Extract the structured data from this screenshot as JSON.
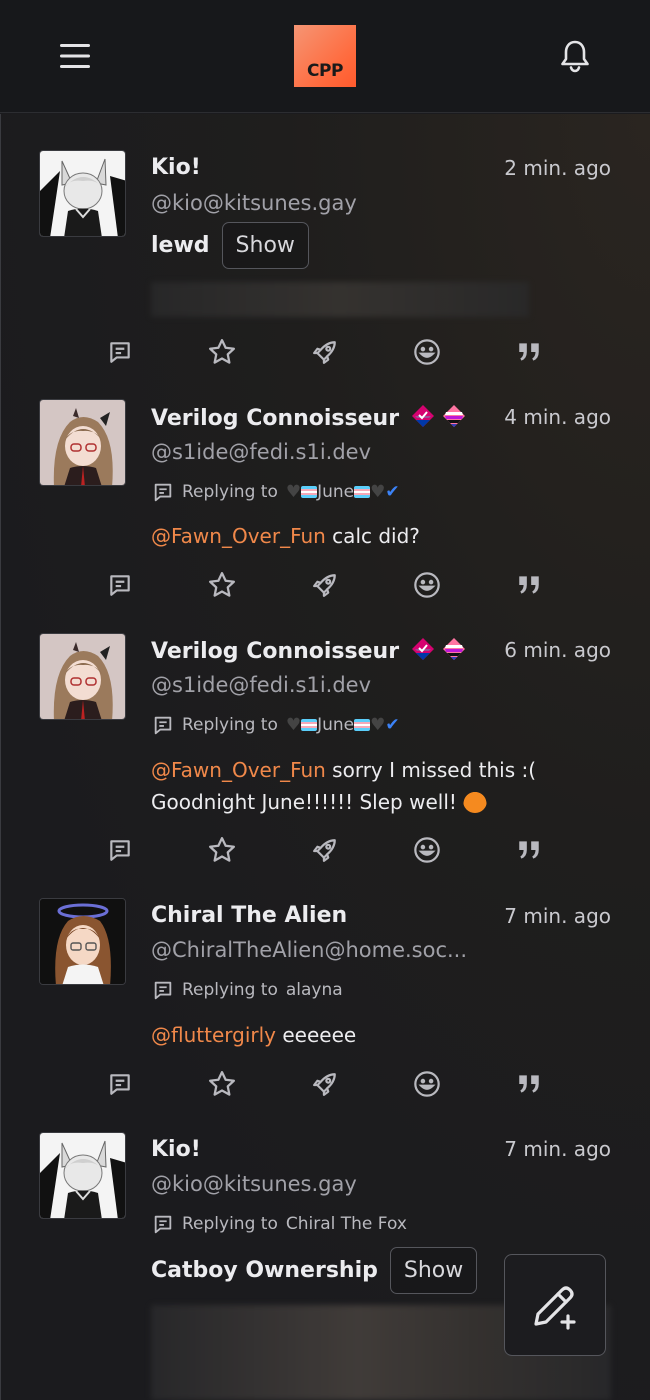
{
  "header": {
    "logo_text": "CPP",
    "menu_icon": "menu-icon",
    "bell_icon": "bell-icon"
  },
  "posts": [
    {
      "name": "Kio!",
      "handle": "@kio@kitsunes.gay",
      "time": "2 min. ago",
      "cw": "lewd",
      "show": "Show"
    },
    {
      "name": "Verilog Connoisseur",
      "handle": "@s1ide@fedi.s1i.dev",
      "time": "4 min. ago",
      "reply_prefix": "Replying to",
      "reply_target": "June",
      "mention": "@Fawn_Over_Fun",
      "text": " calc did?"
    },
    {
      "name": "Verilog Connoisseur",
      "handle": "@s1ide@fedi.s1i.dev",
      "time": "6 min. ago",
      "reply_prefix": "Replying to",
      "reply_target": "June",
      "mention": "@Fawn_Over_Fun",
      "text": " sorry I missed this :(",
      "text2": "Goodnight June!!!!!! Slep well!"
    },
    {
      "name": "Chiral The Alien",
      "handle": "@ChiralTheAlien@home.soc...",
      "time": "7 min. ago",
      "reply_prefix": "Replying to",
      "reply_target": "alayna",
      "mention": "@fluttergirly",
      "text": " eeeeee"
    },
    {
      "name": "Kio!",
      "handle": "@kio@kitsunes.gay",
      "time": "7 min. ago",
      "reply_prefix": "Replying to",
      "reply_target": "Chiral The Fox",
      "cw": "Catboy Ownership",
      "show": "Show"
    }
  ],
  "actions": [
    "reply-icon",
    "favorite-icon",
    "boost-icon",
    "react-icon",
    "quote-icon"
  ],
  "compose_icon": "compose-icon",
  "colors": {
    "accent": "#f0884a",
    "background": "#1b1b1e",
    "logo": "#ff6a3d"
  }
}
